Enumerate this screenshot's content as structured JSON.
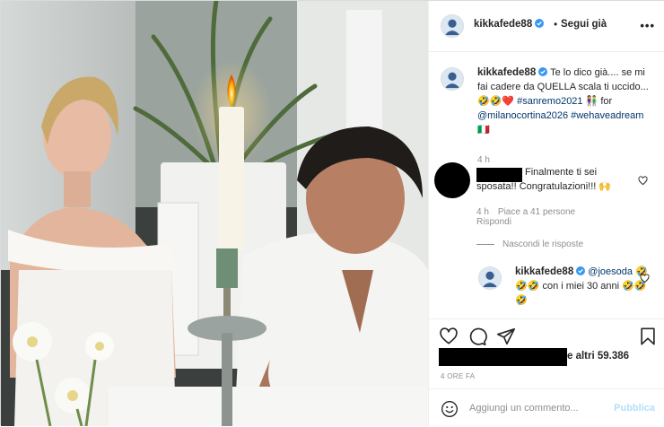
{
  "post": {
    "username": "kikkafede88",
    "follow_label": "Segui già",
    "header_separator": "•",
    "more_label": "•••",
    "caption": {
      "text": "Te lo dico già.... se mi fai cadere da QUELLA scala ti uccido... 🤣🤣❤️",
      "hashtag_1": "#sanremo2021",
      "pair_emoji": "👫",
      "for_word": "for",
      "mention": "@milanocortina2026",
      "hashtag_2": "#wehaveadream",
      "flag": "🇮🇹",
      "time": "4 h"
    },
    "comments": [
      {
        "text": "Finalmente ti sei sposata!! Congratulazioni!!! 🙌",
        "time": "4 h",
        "likes": "Piace a 41 persone",
        "reply_label": "Rispondi"
      }
    ],
    "hide_replies_label": "Nascondi le risposte",
    "reply": {
      "username": "kikkafede88",
      "mention": "@joesoda",
      "text": "🤣🤣🤣 con i miei 30 anni 🤣🤣🤣"
    },
    "likes_text": "e altri 59.386",
    "post_time": "4 ORE FA",
    "comment_placeholder": "Aggiungi un commento...",
    "publish_label": "Pubblica"
  },
  "icons": {
    "verified": "verified-badge-icon",
    "like": "heart-icon",
    "comment": "comment-bubble-icon",
    "share": "paper-plane-icon",
    "save": "bookmark-icon",
    "emoji": "smiley-icon"
  },
  "colors": {
    "link": "#00376b",
    "verified": "#3897f0",
    "secondary_text": "#8e8e8e",
    "publish_disabled": "#b2dffc"
  }
}
